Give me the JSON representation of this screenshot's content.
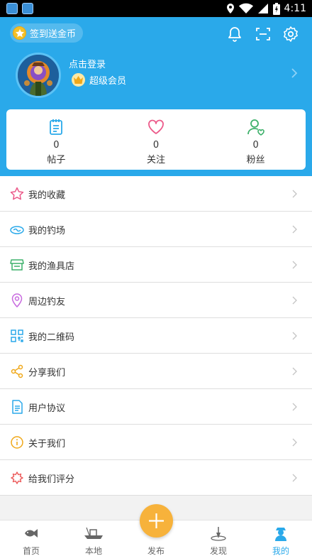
{
  "status_bar": {
    "time": "4:11"
  },
  "header": {
    "checkin_label": "签到送金币",
    "login_text": "点击登录",
    "vip_label": "超级会员"
  },
  "stats": [
    {
      "count": "0",
      "label": "帖子"
    },
    {
      "count": "0",
      "label": "关注"
    },
    {
      "count": "0",
      "label": "粉丝"
    }
  ],
  "menu": [
    {
      "label": "我的收藏",
      "icon": "star-icon"
    },
    {
      "label": "我的钓场",
      "icon": "fishing-spot-icon"
    },
    {
      "label": "我的渔具店",
      "icon": "store-icon"
    },
    {
      "label": "周边钓友",
      "icon": "location-pin-icon"
    },
    {
      "label": "我的二维码",
      "icon": "qr-code-icon"
    },
    {
      "label": "分享我们",
      "icon": "share-icon"
    },
    {
      "label": "用户协议",
      "icon": "document-icon"
    },
    {
      "label": "关于我们",
      "icon": "info-icon"
    },
    {
      "label": "给我们评分",
      "icon": "rating-icon"
    }
  ],
  "tabs": [
    {
      "label": "首页",
      "icon": "fish-icon"
    },
    {
      "label": "本地",
      "icon": "boat-icon"
    },
    {
      "label": "发布",
      "icon": "plus-icon"
    },
    {
      "label": "发现",
      "icon": "float-icon"
    },
    {
      "label": "我的",
      "icon": "user-icon",
      "active": true
    }
  ],
  "colors": {
    "accent": "#2aa9ea",
    "fab": "#f7b23b"
  }
}
